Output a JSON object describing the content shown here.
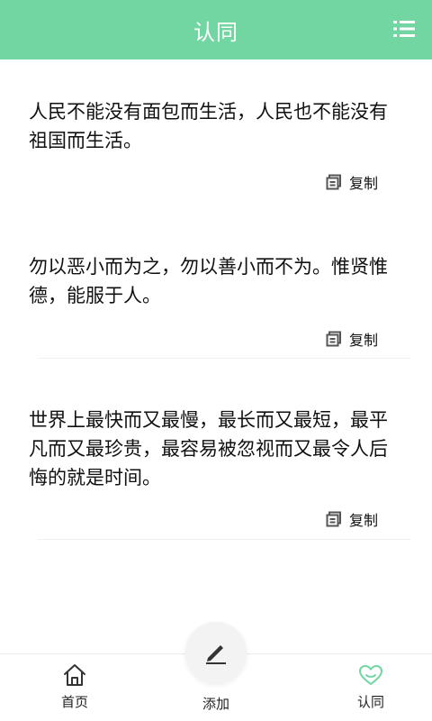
{
  "header": {
    "title": "认同",
    "menu_icon": "menu-list-icon"
  },
  "quotes": [
    {
      "text": "人民不能没有面包而生活，人民也不能没有祖国而生活。",
      "copy_label": "复制"
    },
    {
      "text": "勿以恶小而为之，勿以善小而不为。惟贤惟德，能服于人。",
      "copy_label": "复制"
    },
    {
      "text": "世界上最快而又最慢，最长而又最短，最平凡而又最珍贵，最容易被忽视而又最令人后悔的就是时间。",
      "copy_label": "复制"
    }
  ],
  "tabbar": {
    "home_label": "首页",
    "add_label": "添加",
    "agree_label": "认同"
  },
  "colors": {
    "header": "#72d6a3",
    "active_icon": "#72d6a3"
  }
}
